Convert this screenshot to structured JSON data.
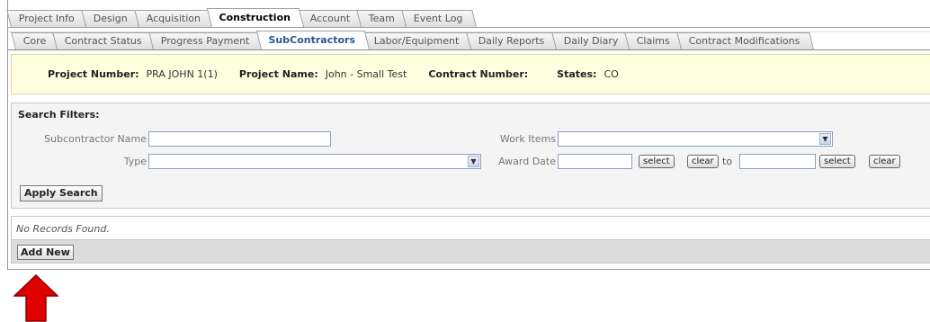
{
  "main_tabs": [
    {
      "label": "Project Info",
      "active": false
    },
    {
      "label": "Design",
      "active": false
    },
    {
      "label": "Acquisition",
      "active": false
    },
    {
      "label": "Construction",
      "active": true
    },
    {
      "label": "Account",
      "active": false
    },
    {
      "label": "Team",
      "active": false
    },
    {
      "label": "Event Log",
      "active": false
    }
  ],
  "sub_tabs": [
    {
      "label": "Core",
      "active": false
    },
    {
      "label": "Contract Status",
      "active": false
    },
    {
      "label": "Progress Payment",
      "active": false
    },
    {
      "label": "SubContractors",
      "active": true
    },
    {
      "label": "Labor/Equipment",
      "active": false
    },
    {
      "label": "Daily Reports",
      "active": false
    },
    {
      "label": "Daily Diary",
      "active": false
    },
    {
      "label": "Claims",
      "active": false
    },
    {
      "label": "Contract Modifications",
      "active": false
    }
  ],
  "project": {
    "number_label": "Project Number:",
    "number_value": "PRA JOHN 1(1)",
    "name_label": "Project Name:",
    "name_value": "John - Small Test",
    "contract_label": "Contract Number:",
    "contract_value": "",
    "states_label": "States:",
    "states_value": "CO"
  },
  "filters": {
    "title": "Search Filters:",
    "subcontractor_name_label": "Subcontractor Name",
    "subcontractor_name_value": "",
    "type_label": "Type",
    "type_value": "",
    "work_items_label": "Work Items",
    "work_items_value": "",
    "award_date_label": "Award Date",
    "award_date_from": "",
    "award_date_to": "",
    "to_label": "to",
    "select_label": "select",
    "clear_label": "clear",
    "apply_label": "Apply Search"
  },
  "results": {
    "empty_message": "No Records Found.",
    "add_new_label": "Add New"
  },
  "colors": {
    "info_bar_bg": "#ffffe0",
    "arrow": "#e00000"
  },
  "icons": {
    "dropdown": "chevron-down-icon",
    "annotation": "up-arrow-icon"
  }
}
